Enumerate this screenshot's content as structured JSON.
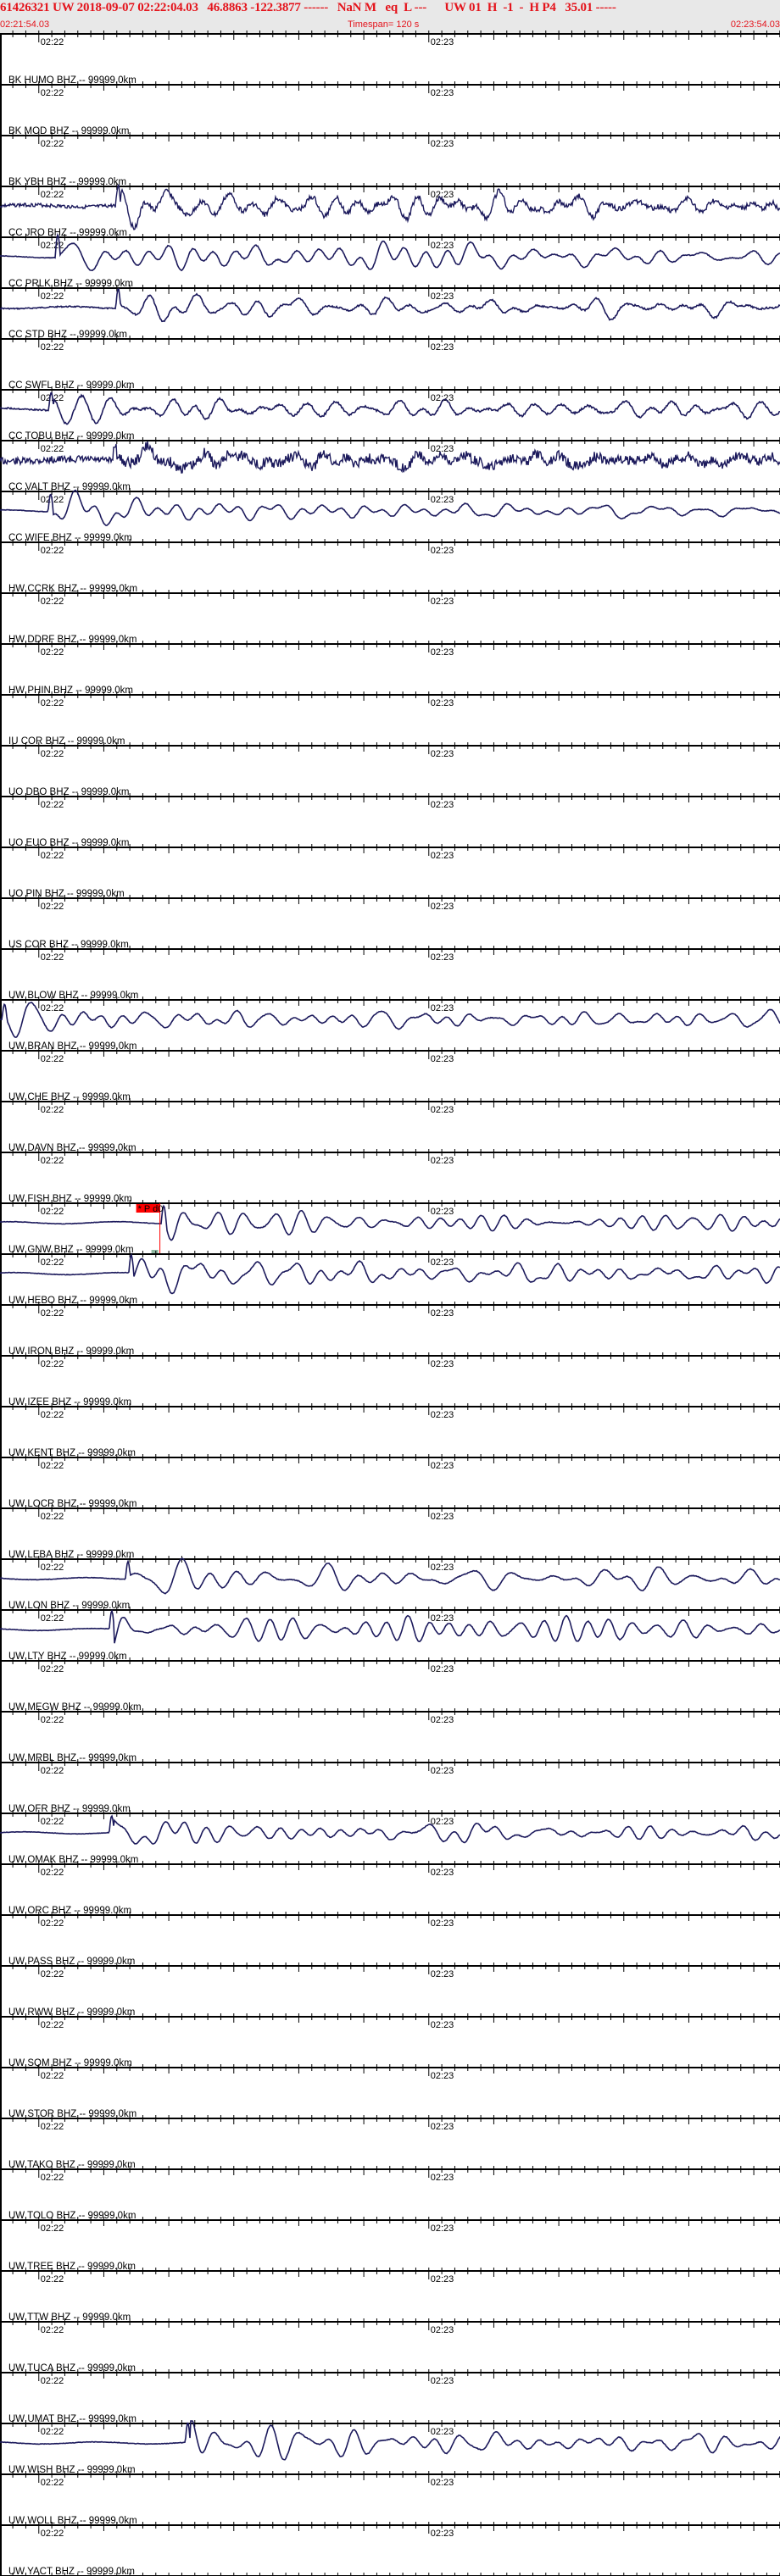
{
  "header": {
    "title": "61426321 UW 2018-09-07 02:22:04.03   46.8863 -122.3877 ------   NaN M   eq  L ---      UW 01  H  -1  -  H P4   35.01 -----",
    "start_time": "02:21:54.03",
    "timespan": "Timespan= 120 s",
    "end_time": "02:23:54.03"
  },
  "time_axis": {
    "start_offset_s": 5.97,
    "span_s": 120,
    "labels": [
      "02:22",
      "02:23"
    ]
  },
  "colors": {
    "trace": "#1c1a5c",
    "header_text": "#e4141c",
    "pick": "#ff0000",
    "header_bg": "#e8e8e8"
  },
  "channels": [
    {
      "label": "BK HUMO BHZ -- 99999.0km"
    },
    {
      "label": "BK MOD BHZ -- 99999.0km"
    },
    {
      "label": "BK YBH BHZ -- 99999.0km",
      "wave": {
        "onset_s": 17.8,
        "amp": 24,
        "noise": 3,
        "seed": 3
      }
    },
    {
      "label": "CC JRO BHZ -- 99999.0km",
      "wave": {
        "onset_s": 8.5,
        "amp": 26,
        "noise": 0.5,
        "seed": 5
      }
    },
    {
      "label": "CC PRLK BHZ -- 99999.0km",
      "wave": {
        "onset_s": 17.8,
        "amp": 22,
        "noise": 1,
        "seed": 7
      }
    },
    {
      "label": "CC STD BHZ -- 99999.0km"
    },
    {
      "label": "CC SWFL BHZ -- 99999.0km",
      "wave": {
        "onset_s": 7.5,
        "amp": 20,
        "noise": 1.2,
        "seed": 11
      }
    },
    {
      "label": "CC TOBU BHZ -- 99999.0km",
      "wave": {
        "onset_s": 17.3,
        "amp": 20,
        "noise": 6,
        "seed": 13
      }
    },
    {
      "label": "CC VALT BHZ -- 99999.0km",
      "wave": {
        "onset_s": 7.4,
        "amp": 20,
        "noise": 0.4,
        "seed": 17
      }
    },
    {
      "label": "CC WIFE BHZ -- 99999.0km"
    },
    {
      "label": "HW CCRK BHZ -- 99999.0km"
    },
    {
      "label": "HW DDRF BHZ -- 99999.0km"
    },
    {
      "label": "HW PHIN BHZ -- 99999.0km"
    },
    {
      "label": "IU COR BHZ -- 99999.0km"
    },
    {
      "label": "UO DBO BHZ -- 99999.0km"
    },
    {
      "label": "UO EUO BHZ -- 99999.0km"
    },
    {
      "label": "UO PIN BHZ -- 99999.0km"
    },
    {
      "label": "US COR BHZ -- 99999.0km"
    },
    {
      "label": "UW BLOW BHZ -- 99999.0km",
      "wave": {
        "onset_s": 0.3,
        "amp": 18,
        "noise": 0.4,
        "seed": 19
      }
    },
    {
      "label": "UW BRAN BHZ -- 99999.0km"
    },
    {
      "label": "UW CHE BHZ -- 99999.0km"
    },
    {
      "label": "UW DAVN BHZ -- 99999.0km"
    },
    {
      "label": "UW FISH BHZ -- 99999.0km",
      "wave": {
        "onset_s": 24.8,
        "amp": 20,
        "noise": 0.4,
        "seed": 23
      },
      "pick": {
        "label": "* P d0",
        "time_s": 24.6
      }
    },
    {
      "label": "UW GNW BHZ -- 99999.0km",
      "wave": {
        "onset_s": 19.8,
        "amp": 22,
        "noise": 0.4,
        "seed": 29
      }
    },
    {
      "label": "UW HEBO BHZ -- 99999.0km"
    },
    {
      "label": "UW IRON BHZ -- 99999.0km"
    },
    {
      "label": "UW IZEE BHZ -- 99999.0km"
    },
    {
      "label": "UW KENT BHZ -- 99999.0km"
    },
    {
      "label": "UW LOCR BHZ -- 99999.0km"
    },
    {
      "label": "UW LEBA BHZ -- 99999.0km",
      "wave": {
        "onset_s": 19.3,
        "amp": 20,
        "noise": 0.4,
        "seed": 31
      }
    },
    {
      "label": "UW LON BHZ -- 99999.0km",
      "wave": {
        "onset_s": 16.8,
        "amp": 22,
        "noise": 0.4,
        "seed": 37
      }
    },
    {
      "label": "UW LTY BHZ -- 99999.0km"
    },
    {
      "label": "UW MEGW BHZ -- 99999.0km"
    },
    {
      "label": "UW MRBL BHZ -- 99999.0km"
    },
    {
      "label": "UW OFR BHZ -- 99999.0km",
      "wave": {
        "onset_s": 16.8,
        "amp": 20,
        "noise": 0.4,
        "seed": 41
      }
    },
    {
      "label": "UW OMAK BHZ -- 99999.0km"
    },
    {
      "label": "UW ORC BHZ -- 99999.0km"
    },
    {
      "label": "UW PASS BHZ -- 99999.0km"
    },
    {
      "label": "UW RWW BHZ -- 99999.0km"
    },
    {
      "label": "UW SQM BHZ -- 99999.0km"
    },
    {
      "label": "UW STOR BHZ -- 99999.0km"
    },
    {
      "label": "UW TAKO BHZ -- 99999.0km"
    },
    {
      "label": "UW TOLO BHZ -- 99999.0km"
    },
    {
      "label": "UW TREE BHZ -- 99999.0km"
    },
    {
      "label": "UW TTW BHZ -- 99999.0km"
    },
    {
      "label": "UW TUCA BHZ -- 99999.0km"
    },
    {
      "label": "UW UMAT BHZ -- 99999.0km",
      "wave": {
        "onset_s": 28.5,
        "amp": 24,
        "noise": 0.4,
        "seed": 43
      }
    },
    {
      "label": "UW WISH BHZ -- 99999.0km"
    },
    {
      "label": "UW WOLL BHZ -- 99999.0km"
    },
    {
      "label": "UW YACT BHZ -- 99999.0km"
    }
  ]
}
